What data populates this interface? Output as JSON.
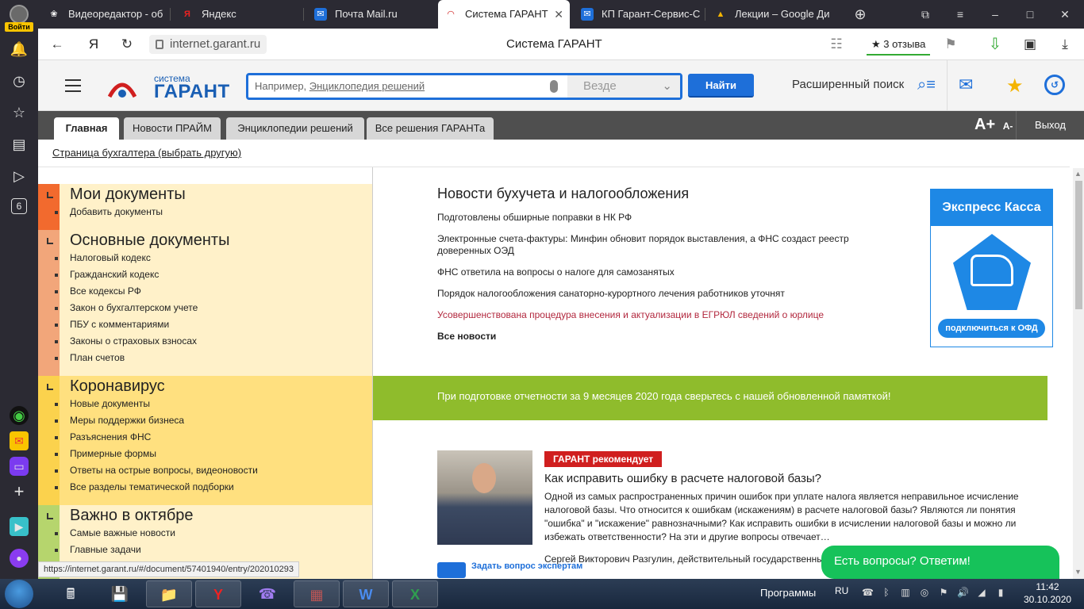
{
  "browser": {
    "profile_login": "Войти",
    "tabs": [
      {
        "title": "Видеоредактор - об",
        "icon": "film-icon",
        "active": false
      },
      {
        "title": "Яндекс",
        "icon": "yandex-icon",
        "active": false
      },
      {
        "title": "Почта Mail.ru",
        "icon": "mail-icon",
        "active": false
      },
      {
        "title": "Система ГАРАНТ",
        "icon": "garant-icon",
        "active": true
      },
      {
        "title": "КП Гарант-Сервис-С",
        "icon": "mail-icon",
        "active": false
      },
      {
        "title": "Лекции – Google Ди",
        "icon": "google-drive-icon",
        "active": false
      }
    ],
    "url": "internet.garant.ru",
    "page_title": "Система ГАРАНТ",
    "reviews": "3 отзыва",
    "sidebar_badge": "6",
    "status_url": "https://internet.garant.ru/#/document/57401940/entry/202010293"
  },
  "garant": {
    "logo_top": "система",
    "logo_main": "ГАРАНТ",
    "search_placeholder_prefix": "Например, ",
    "search_placeholder_link": "Энциклопедия решений",
    "search_scope": "Везде",
    "find_button": "Найти",
    "advanced_search": "Расширенный поиск",
    "nav_tabs": [
      "Главная",
      "Новости ПРАЙМ",
      "Энциклопедии решений",
      "Все решения ГАРАНТа"
    ],
    "font_bigger": "A+",
    "font_smaller": "A-",
    "logout": "Выход",
    "accountant_link": "Страница бухгалтера (выбрать другую)"
  },
  "left_sections": [
    {
      "title": "Мои документы",
      "color": "#f26a2e",
      "items": [
        "Добавить документы"
      ]
    },
    {
      "title": "Основные документы",
      "color": "#f2a67a",
      "items": [
        "Налоговый кодекс",
        "Гражданский кодекс",
        "Все кодексы РФ",
        "Закон о бухгалтерском учете",
        "ПБУ с комментариями",
        "Законы о страховых взносах",
        "План счетов"
      ]
    },
    {
      "title": "Коронавирус",
      "color": "#fbd24d",
      "items": [
        "Новые документы",
        "Меры поддержки бизнеса",
        "Разъяснения ФНС",
        "Примерные формы",
        "Ответы на острые вопросы, видеоновости",
        "Все разделы тематической подборки"
      ]
    },
    {
      "title": "Важно в октябре",
      "color": "#b6d56d",
      "items": [
        "Самые важные новости",
        "Главные задачи"
      ]
    }
  ],
  "news": {
    "title": "Новости бухучета и налогообложения",
    "items": [
      "Подготовлены обширные поправки в НК РФ",
      "Электронные счета-фактуры: Минфин обновит порядок выставления, а ФНС создаст реестр доверенных ОЭД",
      "ФНС ответила на вопросы о налоге для самозанятых",
      "Порядок налогообложения санаторно-курортного лечения работников уточнят",
      "Усовершенствована процедура внесения и актуализации в ЕГРЮЛ сведений о юрлице"
    ],
    "all_link": "Все новости"
  },
  "banner": {
    "title": "Экспресс Касса",
    "button": "подключиться к ОФД"
  },
  "green_notice": "При подготовке отчетности за 9 месяцев 2020 года сверьтесь с нашей обновленной памяткой!",
  "recommend": {
    "badge": "ГАРАНТ рекомендует",
    "title": "Как исправить ошибку в расчете налоговой базы?",
    "text": "Одной из самых распространенных причин ошибок при уплате налога является неправильное исчисление налоговой базы. Что относится к ошибкам (искажениям) в расчете налоговой базы? Являются ли понятия \"ошибка\" и \"искажение\" равнозначными? Как исправить ошибки в исчислении налоговой базы и можно ли избежать ответственности? На эти и другие вопросы отвечает…",
    "author": "Сергей Викторович Разгулин, действительный государственный",
    "ask_experts": "Задать вопрос экспертам"
  },
  "chat_button": "Есть вопросы? Ответим!",
  "taskbar": {
    "programs": "Программы",
    "lang": "RU",
    "time": "11:42",
    "date": "30.10.2020"
  }
}
